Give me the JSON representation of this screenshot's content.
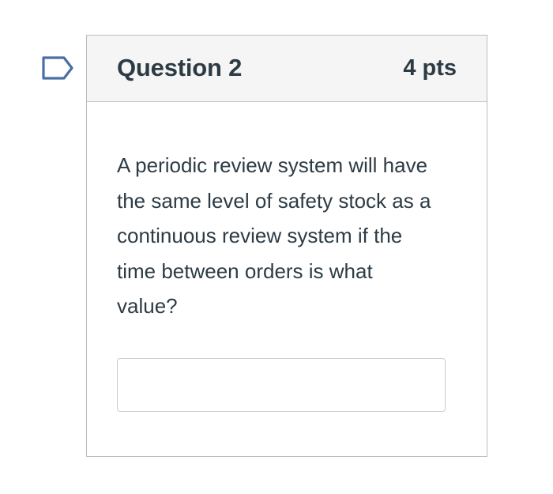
{
  "question": {
    "title": "Question 2",
    "points": "4 pts",
    "text": "A periodic review system will have the same level of safety stock as a continuous review system if the time between orders is what value?",
    "answer_value": "",
    "flag_icon": "flag-outline-icon"
  },
  "colors": {
    "text": "#2d3b45",
    "header_bg": "#f5f5f5",
    "border": "#b8bcbf",
    "flag_stroke": "#4a6fa5"
  }
}
